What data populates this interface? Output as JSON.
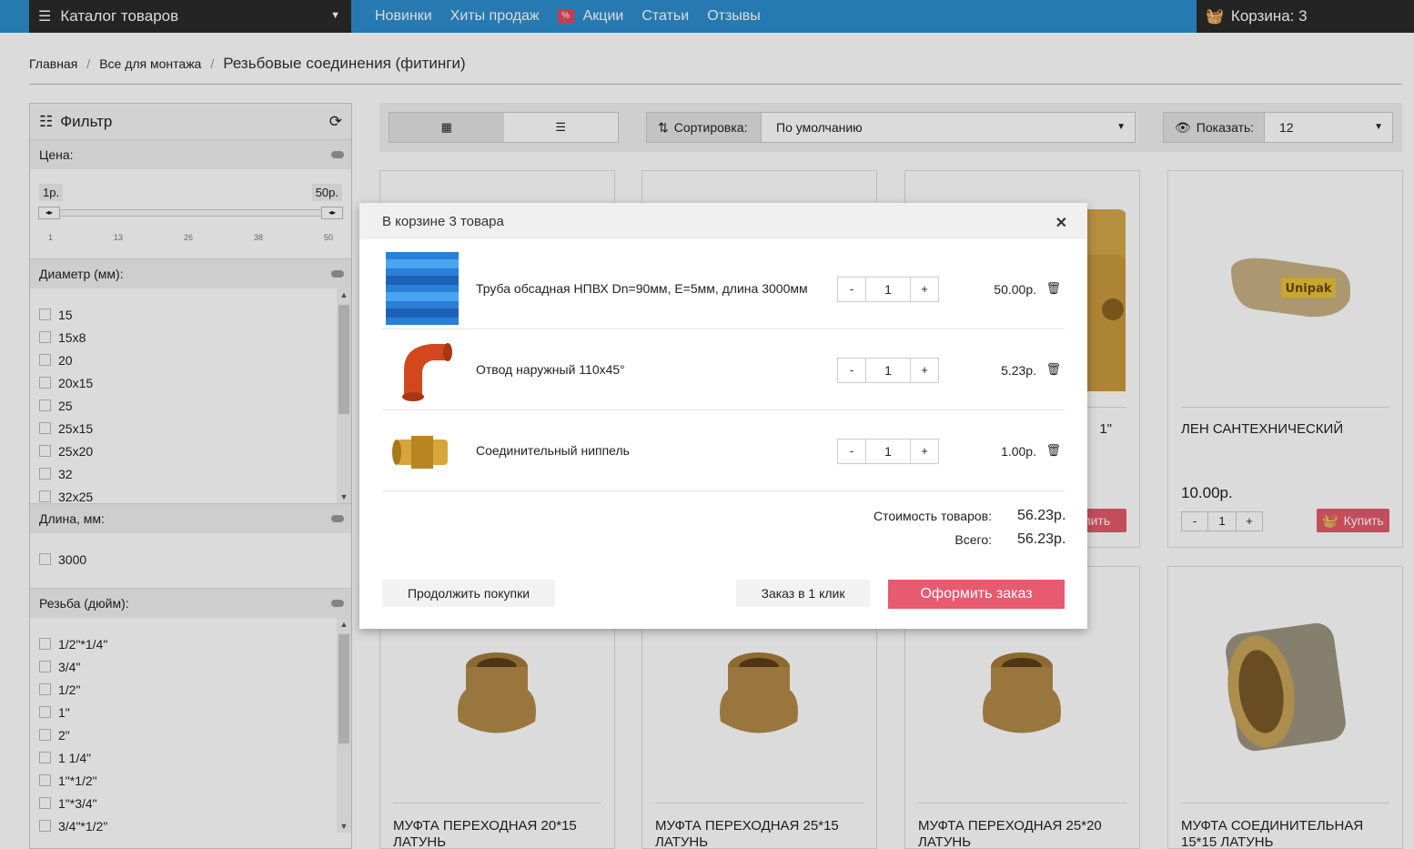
{
  "header": {
    "catalog_label": "Каталог товаров",
    "nav": [
      "Новинки",
      "Хиты продаж",
      "Акции",
      "Статьи",
      "Отзывы"
    ],
    "cart_label": "Корзина: 3"
  },
  "breadcrumb": [
    "Главная",
    "Все для монтажа",
    "Резьбовые соединения (фитинги)"
  ],
  "filter": {
    "title": "Фильтр",
    "price": {
      "label": "Цена:",
      "min": "1р.",
      "max": "50р.",
      "ticks": [
        "1",
        "13",
        "26",
        "38",
        "50"
      ]
    },
    "diameter": {
      "label": "Диаметр (мм):",
      "items": [
        "15",
        "15x8",
        "20",
        "20x15",
        "25",
        "25x15",
        "25x20",
        "32",
        "32x25"
      ]
    },
    "length": {
      "label": "Длина, мм:",
      "items": [
        "3000"
      ]
    },
    "thread": {
      "label": "Резьба (дюйм):",
      "items": [
        "1/2\"*1/4\"",
        "3/4\"",
        "1/2\"",
        "1\"",
        "2\"",
        "1 1/4\"",
        "1\"*1/2\"",
        "1\"*3/4\"",
        "3/4\"*1/2\""
      ]
    }
  },
  "toolbar": {
    "sort_label": "Сортировка:",
    "sort_value": "По умолчанию",
    "show_label": "Показать:",
    "show_value": "12"
  },
  "products": [
    {
      "name": "",
      "price": ""
    },
    {
      "name": "",
      "price": ""
    },
    {
      "name": "1\"",
      "price": "",
      "buy": "Купить"
    },
    {
      "name": "ЛЕН САНТЕХНИЧЕСКИЙ",
      "price": "10.00р.",
      "qty": "1",
      "buy": "Купить"
    },
    {
      "name": "МУФТА ПЕРЕХОДНАЯ 20*15 ЛАТУНЬ"
    },
    {
      "name": "МУФТА ПЕРЕХОДНАЯ 25*15 ЛАТУНЬ"
    },
    {
      "name": "МУФТА ПЕРЕХОДНАЯ 25*20 ЛАТУНЬ"
    },
    {
      "name": "МУФТА СОЕДИНИТЕЛЬНАЯ 15*15 ЛАТУНЬ"
    }
  ],
  "modal": {
    "title": "В корзине 3 товара",
    "items": [
      {
        "name": "Труба обсадная НПВХ Dn=90мм, E=5мм, длина 3000мм",
        "qty": "1",
        "price": "50.00р."
      },
      {
        "name": "Отвод наружный 110х45°",
        "qty": "1",
        "price": "5.23р."
      },
      {
        "name": "Соединительный ниппель",
        "qty": "1",
        "price": "1.00р."
      }
    ],
    "subtotal_label": "Стоимость товаров:",
    "subtotal": "56.23р.",
    "total_label": "Всего:",
    "total": "56.23р.",
    "continue_label": "Продолжить покупки",
    "oneclick_label": "Заказ в 1 клик",
    "checkout_label": "Оформить заказ"
  },
  "colors": {
    "nav_bg": "#2d8ecf",
    "dark_bg": "#2b2b2b",
    "accent": "#e85a70"
  }
}
